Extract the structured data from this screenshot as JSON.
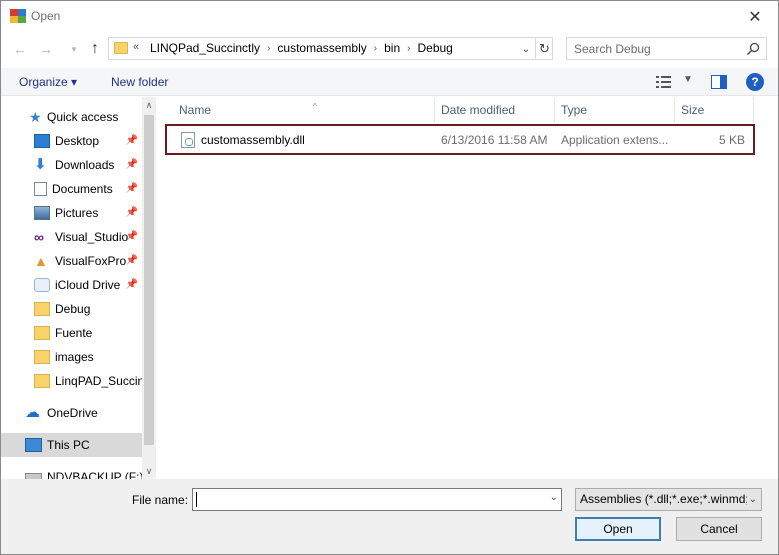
{
  "window": {
    "title": "Open",
    "close_glyph": "✕"
  },
  "address": {
    "overflow_glyph": "«",
    "crumbs": [
      "LINQPad_Succinctly",
      "customassembly",
      "bin",
      "Debug"
    ],
    "separator": "›"
  },
  "search": {
    "placeholder": "Search Debug"
  },
  "toolbar": {
    "organize_label": "Organize ▾",
    "new_folder_label": "New folder",
    "help_label": "?"
  },
  "nav": {
    "items": [
      {
        "label": "Quick access",
        "icon": "star-icon"
      },
      {
        "label": "Desktop",
        "icon": "desktop-icon",
        "pinned": true
      },
      {
        "label": "Downloads",
        "icon": "download-icon",
        "pinned": true
      },
      {
        "label": "Documents",
        "icon": "documents-icon",
        "pinned": true
      },
      {
        "label": "Pictures",
        "icon": "pictures-icon",
        "pinned": true
      },
      {
        "label": "Visual_Studio",
        "icon": "visual-studio-icon",
        "pinned": true
      },
      {
        "label": "VisualFoxPro",
        "icon": "foxpro-icon",
        "pinned": true
      },
      {
        "label": "iCloud Drive",
        "icon": "cloud-icon",
        "pinned": true
      },
      {
        "label": "Debug",
        "icon": "folder-icon"
      },
      {
        "label": "Fuente",
        "icon": "folder-icon"
      },
      {
        "label": "images",
        "icon": "folder-icon"
      },
      {
        "label": "LinqPAD_Succin",
        "icon": "folder-icon"
      },
      {
        "label": "OneDrive",
        "icon": "onedrive-icon"
      },
      {
        "label": "This PC",
        "icon": "pc-icon"
      },
      {
        "label": "NDVBACKUP (F:)",
        "icon": "drive-icon"
      }
    ]
  },
  "columns": [
    "Name",
    "Date modified",
    "Type",
    "Size"
  ],
  "files": [
    {
      "name": "customassembly.dll",
      "date": "6/13/2016 11:58 AM",
      "type": "Application extens...",
      "size": "5 KB"
    }
  ],
  "bottom": {
    "file_name_label": "File name:",
    "file_name_value": "",
    "file_type_value": "Assemblies (*.dll;*.exe;*.winmd;",
    "open_label": "Open",
    "cancel_label": "Cancel"
  },
  "colors": {
    "selection_outline": "#6b1b1b",
    "link_blue": "#1e3287",
    "help_blue": "#1f5fbf"
  }
}
